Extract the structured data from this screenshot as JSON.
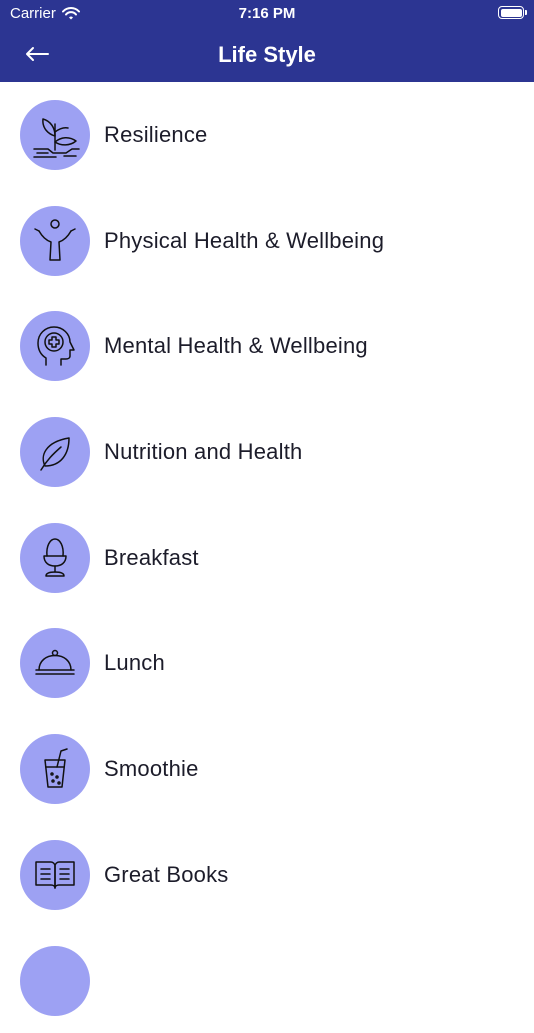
{
  "status_bar": {
    "carrier": "Carrier",
    "time": "7:16 PM"
  },
  "header": {
    "title": "Life Style"
  },
  "colors": {
    "header_bg": "#2c3592",
    "icon_circle": "#9da1f3"
  },
  "items": [
    {
      "label": "Resilience",
      "icon": "plant-sprout-icon"
    },
    {
      "label": "Physical Health & Wellbeing",
      "icon": "person-arms-raised-icon"
    },
    {
      "label": "Mental Health & Wellbeing",
      "icon": "head-medical-cross-icon"
    },
    {
      "label": "Nutrition and Health",
      "icon": "leaf-icon"
    },
    {
      "label": "Breakfast",
      "icon": "egg-cup-icon"
    },
    {
      "label": "Lunch",
      "icon": "food-cloche-icon"
    },
    {
      "label": "Smoothie",
      "icon": "drink-glass-straw-icon"
    },
    {
      "label": "Great Books",
      "icon": "open-book-icon"
    }
  ]
}
